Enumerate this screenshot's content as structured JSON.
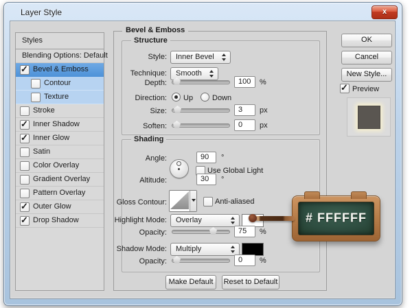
{
  "window": {
    "title": "Layer Style",
    "close_glyph": "x"
  },
  "sidebar": {
    "header": "Styles",
    "items": [
      {
        "label": "Blending Options: Default",
        "checkbox": false,
        "checked": false,
        "selected": false,
        "sub": false
      },
      {
        "label": "Bevel & Emboss",
        "checkbox": true,
        "checked": true,
        "selected": true,
        "sub": false
      },
      {
        "label": "Contour",
        "checkbox": true,
        "checked": false,
        "selected": false,
        "sub": true
      },
      {
        "label": "Texture",
        "checkbox": true,
        "checked": false,
        "selected": false,
        "sub": true
      },
      {
        "label": "Stroke",
        "checkbox": true,
        "checked": false,
        "selected": false,
        "sub": false
      },
      {
        "label": "Inner Shadow",
        "checkbox": true,
        "checked": true,
        "selected": false,
        "sub": false
      },
      {
        "label": "Inner Glow",
        "checkbox": true,
        "checked": true,
        "selected": false,
        "sub": false
      },
      {
        "label": "Satin",
        "checkbox": true,
        "checked": false,
        "selected": false,
        "sub": false
      },
      {
        "label": "Color Overlay",
        "checkbox": true,
        "checked": false,
        "selected": false,
        "sub": false
      },
      {
        "label": "Gradient Overlay",
        "checkbox": true,
        "checked": false,
        "selected": false,
        "sub": false
      },
      {
        "label": "Pattern Overlay",
        "checkbox": true,
        "checked": false,
        "selected": false,
        "sub": false
      },
      {
        "label": "Outer Glow",
        "checkbox": true,
        "checked": true,
        "selected": false,
        "sub": false
      },
      {
        "label": "Drop Shadow",
        "checkbox": true,
        "checked": true,
        "selected": false,
        "sub": false
      }
    ],
    "selected_color": "#5d9cdf"
  },
  "main": {
    "title": "Bevel & Emboss",
    "structure": {
      "legend": "Structure",
      "style": {
        "label": "Style:",
        "value": "Inner Bevel"
      },
      "technique": {
        "label": "Technique:",
        "value": "Smooth"
      },
      "depth": {
        "label": "Depth:",
        "value": "100",
        "unit": "%"
      },
      "direction": {
        "label": "Direction:",
        "up": "Up",
        "down": "Down",
        "selected": "Up"
      },
      "size": {
        "label": "Size:",
        "value": "3",
        "unit": "px"
      },
      "soften": {
        "label": "Soften:",
        "value": "0",
        "unit": "px"
      }
    },
    "shading": {
      "legend": "Shading",
      "angle": {
        "label": "Angle:",
        "value": "90",
        "unit": "°"
      },
      "use_global_light": "Use Global Light",
      "altitude": {
        "label": "Altitude:",
        "value": "30",
        "unit": "°"
      },
      "gloss_contour": {
        "label": "Gloss Contour:"
      },
      "anti_aliased": "Anti-aliased",
      "highlight_mode": {
        "label": "Highlight Mode:",
        "value": "Overlay",
        "swatch": "#ffffff"
      },
      "highlight_opacity": {
        "label": "Opacity:",
        "value": "75",
        "unit": "%"
      },
      "shadow_mode": {
        "label": "Shadow Mode:",
        "value": "Multiply",
        "swatch": "#000000"
      },
      "shadow_opacity": {
        "label": "Opacity:",
        "value": "0",
        "unit": "%"
      }
    },
    "buttons": {
      "make_default": "Make Default",
      "reset_to_default": "Reset to Default"
    }
  },
  "actions": {
    "ok": "OK",
    "cancel": "Cancel",
    "new_style": "New Style...",
    "preview": "Preview"
  },
  "annotation": {
    "text": "# FFFFFF",
    "board_color": "#2e4d40",
    "frame_color": "#b57c48"
  }
}
